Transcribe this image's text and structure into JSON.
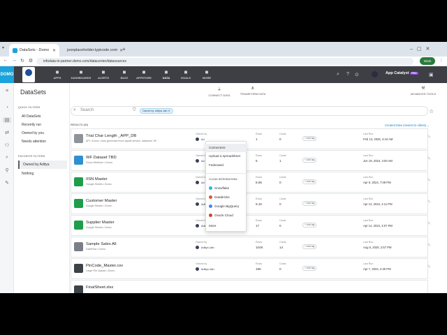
{
  "browser": {
    "tabs": [
      {
        "title": "DataSets - Domo",
        "active": true
      },
      {
        "title": "jsonplaceholder.typicode.com",
        "active": false
      }
    ],
    "url": "infodata-in-partner.domo.com/datacenter/datasources",
    "profile": "Work"
  },
  "domo": {
    "logo": "DOMO",
    "nav": [
      {
        "label": "APPS",
        "icon": "apps-icon"
      },
      {
        "label": "DASHBOARDS",
        "icon": "dashboards-icon"
      },
      {
        "label": "ALERTS",
        "icon": "alerts-icon"
      },
      {
        "label": "BUZZ",
        "icon": "buzz-icon"
      },
      {
        "label": "APPSTORE",
        "icon": "appstore-icon"
      },
      {
        "label": "DATA",
        "icon": "data-icon",
        "active": true
      },
      {
        "label": "GOALS",
        "icon": "goals-icon"
      },
      {
        "label": "MORE",
        "icon": "more-icon"
      }
    ],
    "app_catalyst": "App Catalyst",
    "app_catalyst_badge": "PRO"
  },
  "sidebar": {
    "title": "DataSets",
    "quick_filters_label": "QUICK FILTERS",
    "quick_filters": [
      "All DataSets",
      "Recently run",
      "Owned by you",
      "Needs attention"
    ],
    "favorite_filters_label": "FAVORITE FILTERS",
    "favorite_filters": [
      "Owned by Aditya",
      "Nothing"
    ]
  },
  "subnav": {
    "connect": "CONNECT DATA",
    "transform": "TRANSFORM DATA",
    "advanced": "ADVANCED TOOLS"
  },
  "search": {
    "placeholder": "Search",
    "chip": "Owned by: Aditya Jain"
  },
  "results_label": "RESULTS (82)",
  "sort_label": "Created Date (newest to oldest)",
  "labels": {
    "owned_by": "Owned by",
    "rows": "Rows",
    "cards": "Cards",
    "last_run": "Last Run",
    "add_tag": "+ Add tag"
  },
  "datasets": [
    {
      "name": "Trial Char Length _APP_DB",
      "sub": "API • Domo • Auto-generated from appdb service. datastore: 6F...",
      "owner": "Ad",
      "rows": "1",
      "cards": "0",
      "last_run": "Feb 13, 2025, 4:44 AM",
      "icon_color": "#8f949b"
    },
    {
      "name": "WF Dataset TBD",
      "sub": "Domo Webform • Domo",
      "owner": "Ad",
      "rows": "6",
      "cards": "1",
      "last_run": "Jun 19, 2024, 4:00 AM",
      "icon_color": "#2f8fd0"
    },
    {
      "name": "IISN Master",
      "sub": "Google Sheets • Domo",
      "owner": "Ad",
      "rows": "8.5K",
      "cards": "0",
      "last_run": "Apr 9, 2024, 7:09 PM",
      "icon_color": "#1e9e4a"
    },
    {
      "name": "Customer Master",
      "sub": "Google Sheets • Domo",
      "owner": "Aditya Jain",
      "rows": "9.1K",
      "cards": "0",
      "last_run": "Apr 14, 2024, 4:11 PM",
      "icon_color": "#1e9e4a"
    },
    {
      "name": "Supplier Master",
      "sub": "Google Sheets • Domo",
      "owner": "Aditya Jain",
      "rows": "17",
      "cards": "0",
      "last_run": "Apr 14, 2024, 4:07 PM",
      "icon_color": "#1e9e4a"
    },
    {
      "name": "Sample Sales All",
      "sub": "DataFlow • Domo",
      "owner": "Aditya Jain",
      "rows": "104K",
      "cards": "14",
      "last_run": "Aug 6, 2025, 2:57 PM",
      "icon_color": "#7a7f86"
    },
    {
      "name": "PinCode_Master.csv",
      "sub": "Large File Upload • Domo",
      "owner": "Aditya Jain",
      "rows": "19K",
      "cards": "0",
      "last_run": "Apr 7, 2024, 2:30 PM",
      "icon_color": "#3d4248"
    },
    {
      "name": "FinalSheet.xlsx",
      "sub": "",
      "owner": "",
      "rows": "",
      "cards": "",
      "last_run": "",
      "icon_color": "#3d4248"
    }
  ],
  "menu": {
    "items": [
      "Connectors",
      "Upload a spreadsheet",
      "Federated"
    ],
    "cloud_label": "CLOUD INTEGRATIONS",
    "cloud": [
      {
        "label": "Snowflake",
        "color": "#29b5e8"
      },
      {
        "label": "Databricks",
        "color": "#e0533a"
      },
      {
        "label": "Google BigQuery",
        "color": "#4285f4"
      },
      {
        "label": "Oracle Cloud",
        "color": "#c74634"
      }
    ],
    "more": "More"
  }
}
